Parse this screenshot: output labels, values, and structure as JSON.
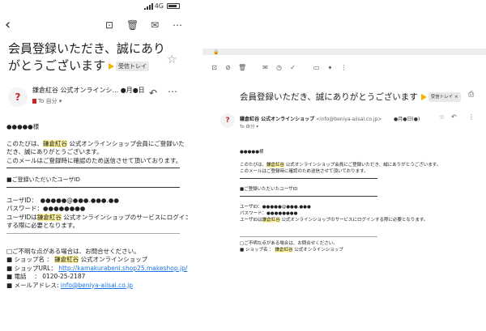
{
  "mobile": {
    "status": {
      "network": "4G"
    },
    "title": "会員登録いただき、誠にありがとうございます",
    "label": "受信トレイ",
    "sender": "鎌倉紅谷 公式オンラインシ...",
    "date": "●月●日",
    "to": "To 自分",
    "body": {
      "greeting": "●●●●●様",
      "intro1_a": "このたびは、",
      "intro1_hl": "鎌倉紅谷",
      "intro1_b": " 公式オンラインショップ会員にご登録いた",
      "intro2": "だき、誠にありがとうございます。",
      "intro3": "このメールはご登録時に確認のため送信させて頂いております。",
      "section_title": "■ご登録いただいたユーザID",
      "userid": "ユーザID：　●●●●●@●●●.●●●.●●",
      "password": "パスワード：●●●●●●●●",
      "login1_a": "ユーザIDは",
      "login1_hl": "鎌倉紅谷",
      "login1_b": " 公式オンラインショップのサービスにログイン",
      "login2": "する際に必要となります。",
      "contact_title": "□ご不明な点がある場合は、お問合せください。",
      "shop_name_label": "■ ショップ名 ： ",
      "shop_name_hl": "鎌倉紅谷",
      "shop_name_rest": " 公式オンラインショップ",
      "shop_url_label": "■ ショップURL： ",
      "shop_url": "http://kamakurabeni.shop25.makeshop.jp/",
      "phone": "■ 電話　 ： 0120-25-2187",
      "email_label": "■ メールアドレス: ",
      "email": "info@beniya-aiisai.co.jp"
    }
  },
  "desktop": {
    "title": "会員登録いただき、誠にありがとうございます",
    "label": "受信トレイ ×",
    "sender": "鎌倉紅谷 公式オンラインショップ",
    "sender_address": "<info@beniya-aiisai.co.jp>",
    "date": "●月●日(●)",
    "to": "To 自分",
    "body": {
      "greeting": "●●●●●様",
      "intro1_a": "このたびは、",
      "intro1_hl": "鎌倉紅谷",
      "intro1_b": " 公式オンラインショップ会員にご登録いただき、誠にありがとうございます。",
      "intro2": "このメールはご登録時に確認のため送信させて頂いております。",
      "section_title": "■ご登録いただいたユーザID",
      "userid": "ユーザID：●●●●●@●●●.●●●",
      "password": "パスワード：●●●●●●●●",
      "login_a": "ユーザIDは",
      "login_hl": "鎌倉紅谷",
      "login_b": " 公式オンラインショップのサービスにログインする際に必要となります。",
      "contact_title": "□ご不明な点がある場合は、お問合せください。",
      "shop_name_label": "■ ショップ名 ： ",
      "shop_name_hl": "鎌倉紅谷",
      "shop_name_rest": " 公式オンラインショップ"
    }
  },
  "colors": {
    "accent": "#1a73e8",
    "important": "#f4b400",
    "highlight": "#fff59d",
    "logo": "#c62828"
  }
}
